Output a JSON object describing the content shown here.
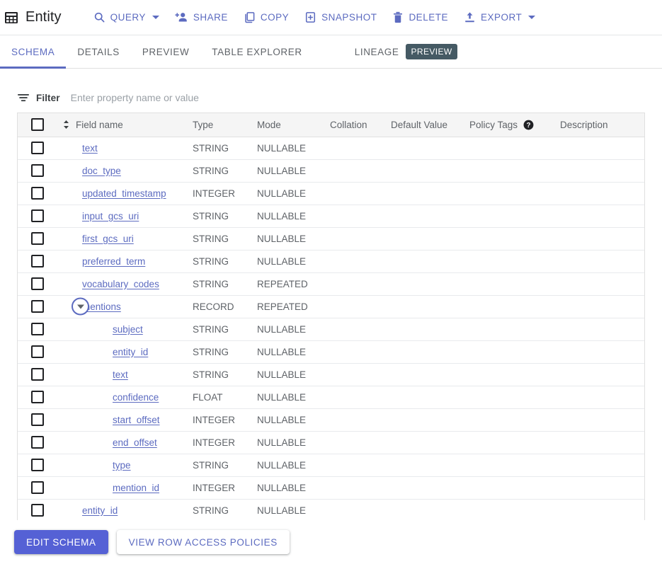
{
  "header": {
    "table_icon": "table-grid-icon",
    "title": "Entity",
    "actions": [
      {
        "id": "query",
        "label": "QUERY",
        "icon": "search-icon",
        "has_caret": true
      },
      {
        "id": "share",
        "label": "SHARE",
        "icon": "person-add-icon",
        "has_caret": false
      },
      {
        "id": "copy",
        "label": "COPY",
        "icon": "copy-icon",
        "has_caret": false
      },
      {
        "id": "snapshot",
        "label": "SNAPSHOT",
        "icon": "snapshot-icon",
        "has_caret": false
      },
      {
        "id": "delete",
        "label": "DELETE",
        "icon": "trash-icon",
        "has_caret": false
      },
      {
        "id": "export",
        "label": "EXPORT",
        "icon": "upload-icon",
        "has_caret": true
      }
    ]
  },
  "tabs": {
    "items": [
      {
        "id": "schema",
        "label": "SCHEMA",
        "active": true
      },
      {
        "id": "details",
        "label": "DETAILS",
        "active": false
      },
      {
        "id": "preview",
        "label": "PREVIEW",
        "active": false
      },
      {
        "id": "table-explorer",
        "label": "TABLE EXPLORER",
        "active": false
      },
      {
        "id": "lineage",
        "label": "LINEAGE",
        "active": false
      }
    ],
    "lineage_badge": "PREVIEW"
  },
  "filter": {
    "icon": "filter-list-icon",
    "label": "Filter",
    "placeholder": "Enter property name or value",
    "value": ""
  },
  "table": {
    "columns": [
      {
        "id": "checkbox",
        "label": ""
      },
      {
        "id": "field_name",
        "label": "Field name"
      },
      {
        "id": "type",
        "label": "Type"
      },
      {
        "id": "mode",
        "label": "Mode"
      },
      {
        "id": "collation",
        "label": "Collation"
      },
      {
        "id": "default_value",
        "label": "Default Value"
      },
      {
        "id": "policy_tags",
        "label": "Policy Tags"
      },
      {
        "id": "description",
        "label": "Description"
      }
    ],
    "policy_tags_help_icon": "help-circle-icon",
    "sort_icon": "sort-updown-icon",
    "rows": [
      {
        "name": "text",
        "type": "STRING",
        "mode": "NULLABLE",
        "collation": "",
        "default_value": "",
        "policy_tags": "",
        "description": "",
        "level": 0,
        "toggle": null
      },
      {
        "name": "doc_type",
        "type": "STRING",
        "mode": "NULLABLE",
        "collation": "",
        "default_value": "",
        "policy_tags": "",
        "description": "",
        "level": 0,
        "toggle": null
      },
      {
        "name": "updated_timestamp",
        "type": "INTEGER",
        "mode": "NULLABLE",
        "collation": "",
        "default_value": "",
        "policy_tags": "",
        "description": "",
        "level": 0,
        "toggle": null
      },
      {
        "name": "input_gcs_uri",
        "type": "STRING",
        "mode": "NULLABLE",
        "collation": "",
        "default_value": "",
        "policy_tags": "",
        "description": "",
        "level": 0,
        "toggle": null
      },
      {
        "name": "first_gcs_uri",
        "type": "STRING",
        "mode": "NULLABLE",
        "collation": "",
        "default_value": "",
        "policy_tags": "",
        "description": "",
        "level": 0,
        "toggle": null
      },
      {
        "name": "preferred_term",
        "type": "STRING",
        "mode": "NULLABLE",
        "collation": "",
        "default_value": "",
        "policy_tags": "",
        "description": "",
        "level": 0,
        "toggle": null
      },
      {
        "name": "vocabulary_codes",
        "type": "STRING",
        "mode": "REPEATED",
        "collation": "",
        "default_value": "",
        "policy_tags": "",
        "description": "",
        "level": 0,
        "toggle": null
      },
      {
        "name": "mentions",
        "type": "RECORD",
        "mode": "REPEATED",
        "collation": "",
        "default_value": "",
        "policy_tags": "",
        "description": "",
        "level": 0,
        "toggle": "expanded"
      },
      {
        "name": "subject",
        "type": "STRING",
        "mode": "NULLABLE",
        "collation": "",
        "default_value": "",
        "policy_tags": "",
        "description": "",
        "level": 1,
        "toggle": null
      },
      {
        "name": "entity_id",
        "type": "STRING",
        "mode": "NULLABLE",
        "collation": "",
        "default_value": "",
        "policy_tags": "",
        "description": "",
        "level": 1,
        "toggle": null
      },
      {
        "name": "text",
        "type": "STRING",
        "mode": "NULLABLE",
        "collation": "",
        "default_value": "",
        "policy_tags": "",
        "description": "",
        "level": 1,
        "toggle": null
      },
      {
        "name": "confidence",
        "type": "FLOAT",
        "mode": "NULLABLE",
        "collation": "",
        "default_value": "",
        "policy_tags": "",
        "description": "",
        "level": 1,
        "toggle": null
      },
      {
        "name": "start_offset",
        "type": "INTEGER",
        "mode": "NULLABLE",
        "collation": "",
        "default_value": "",
        "policy_tags": "",
        "description": "",
        "level": 1,
        "toggle": null
      },
      {
        "name": "end_offset",
        "type": "INTEGER",
        "mode": "NULLABLE",
        "collation": "",
        "default_value": "",
        "policy_tags": "",
        "description": "",
        "level": 1,
        "toggle": null
      },
      {
        "name": "type",
        "type": "STRING",
        "mode": "NULLABLE",
        "collation": "",
        "default_value": "",
        "policy_tags": "",
        "description": "",
        "level": 1,
        "toggle": null
      },
      {
        "name": "mention_id",
        "type": "INTEGER",
        "mode": "NULLABLE",
        "collation": "",
        "default_value": "",
        "policy_tags": "",
        "description": "",
        "level": 1,
        "toggle": null
      },
      {
        "name": "entity_id",
        "type": "STRING",
        "mode": "NULLABLE",
        "collation": "",
        "default_value": "",
        "policy_tags": "",
        "description": "",
        "level": 0,
        "toggle": null
      }
    ]
  },
  "footer": {
    "edit_schema_label": "EDIT SCHEMA",
    "view_row_access_policies_label": "VIEW ROW ACCESS POLICIES"
  },
  "colors": {
    "accent_blue": "#5c6bc0",
    "primary_button": "#5561d5",
    "preview_badge": "#455a64",
    "header_row_bg": "#f5f5f5",
    "border": "#e0e0e0",
    "text_secondary": "#5f6368"
  }
}
